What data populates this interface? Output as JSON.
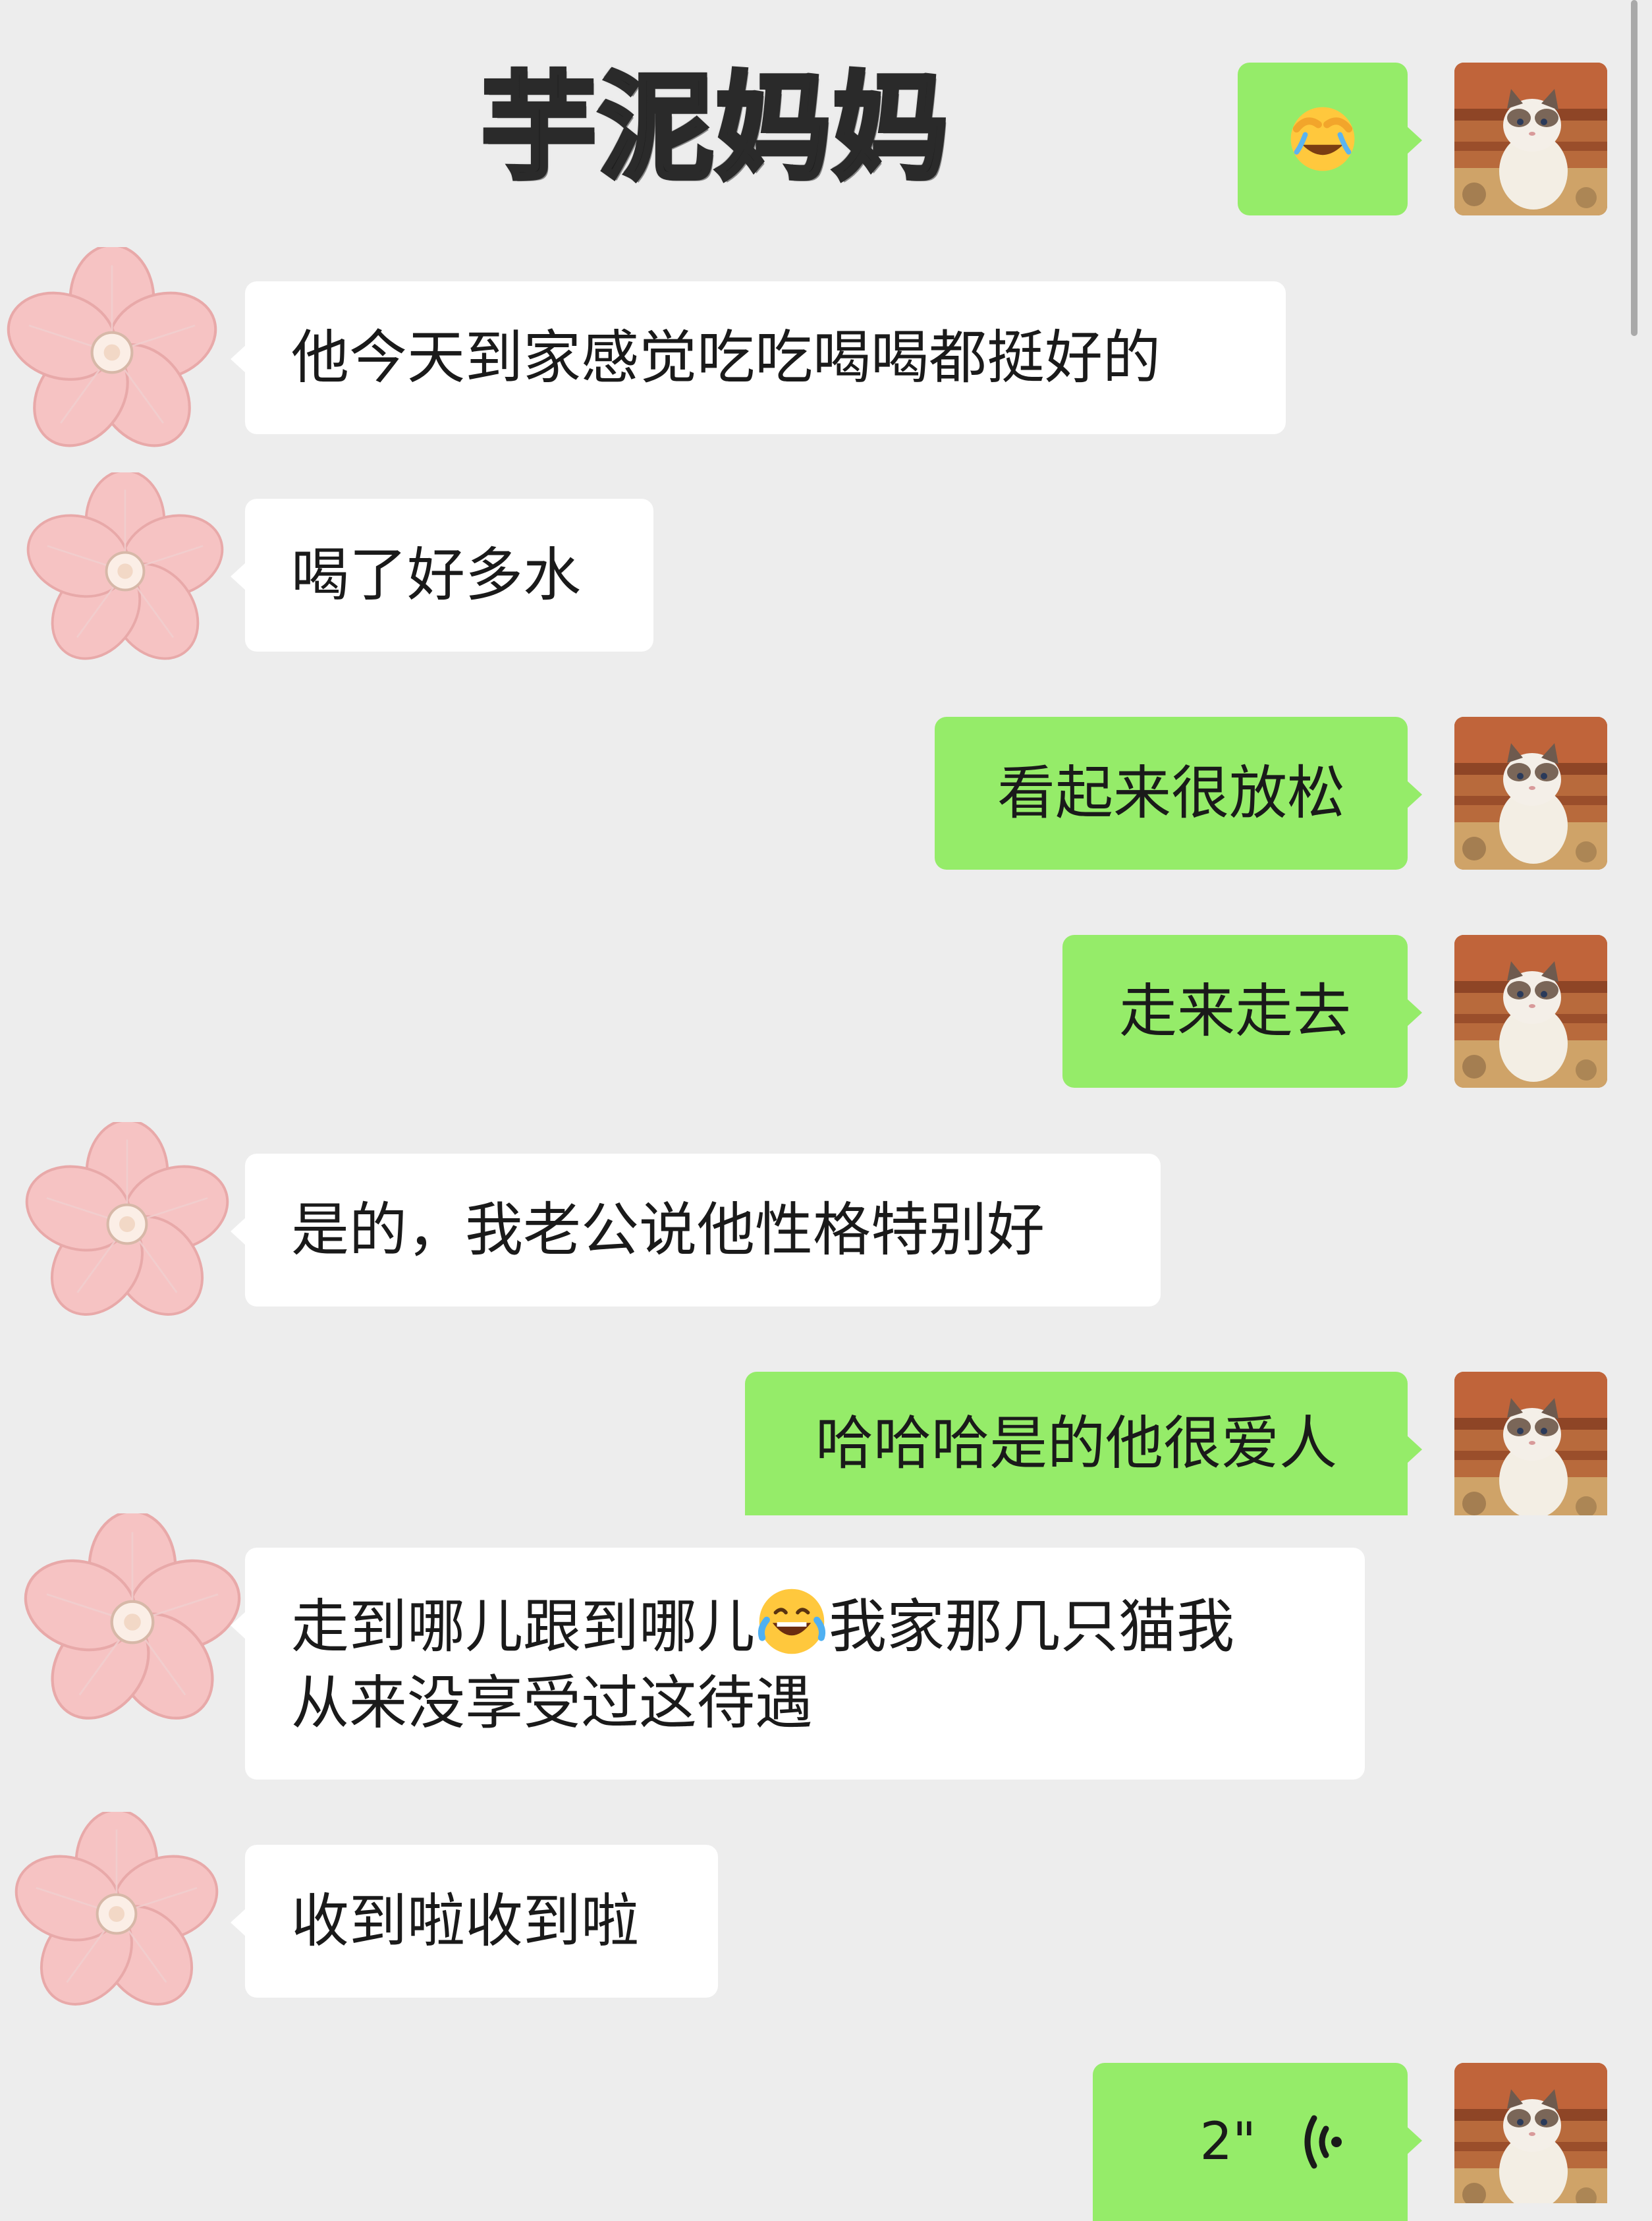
{
  "header": {
    "title": "芋泥妈妈"
  },
  "colors": {
    "background": "#ededed",
    "outgoing_bubble": "#95ec69",
    "incoming_bubble": "#ffffff"
  },
  "avatars": {
    "me": "cat-avatar-icon",
    "them": "pink-flower-avatar-icon"
  },
  "messages": [
    {
      "side": "right",
      "type": "emoji",
      "emoji": "face-with-tears-covering-face-icon"
    },
    {
      "side": "left",
      "text": "他今天到家感觉吃吃喝喝都挺好的"
    },
    {
      "side": "left",
      "text": "喝了好多水"
    },
    {
      "side": "right",
      "text": "看起来很放松"
    },
    {
      "side": "right",
      "text": "走来走去"
    },
    {
      "side": "left",
      "text": "是的，我老公说他性格特别好"
    },
    {
      "side": "right",
      "text": "哈哈哈是的他很爱人"
    },
    {
      "side": "left",
      "text_part1": "走到哪儿跟到哪儿",
      "emoji": "laughing-tears-icon",
      "text_part2": "我家那几只猫我",
      "text_line2": "从来没享受过这待遇"
    },
    {
      "side": "left",
      "text": "收到啦收到啦"
    },
    {
      "side": "right",
      "type": "voice",
      "duration": "2\""
    }
  ]
}
